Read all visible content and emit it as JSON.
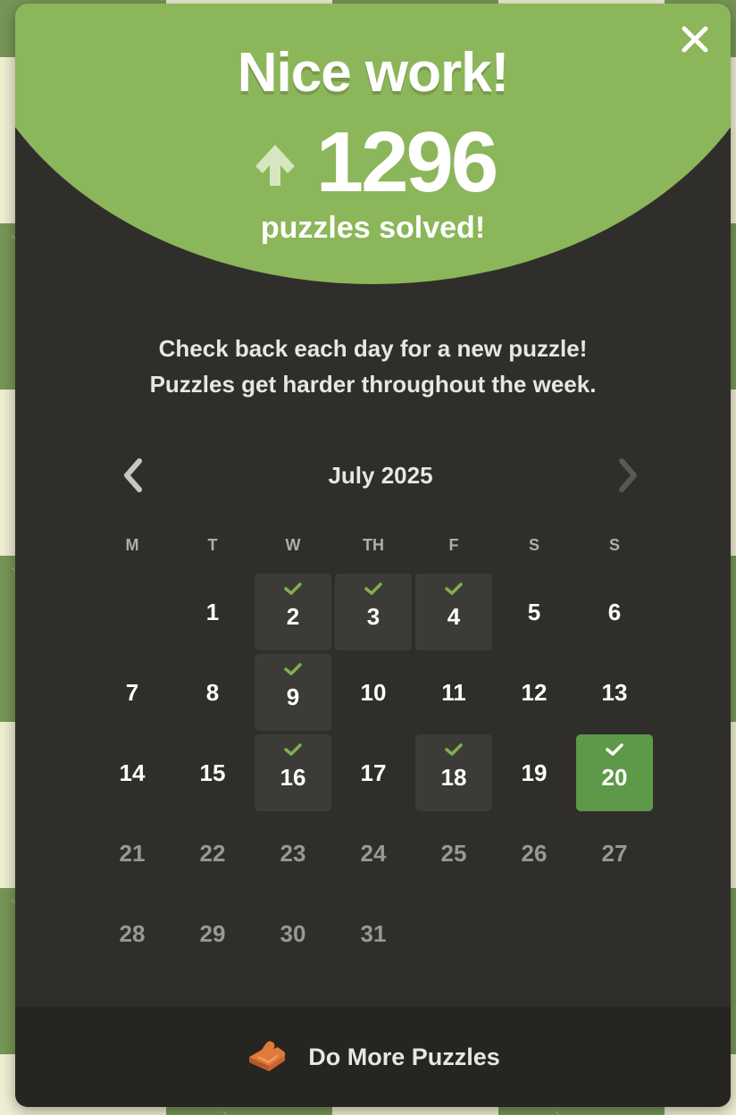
{
  "modal": {
    "title": "Nice work!",
    "count": "1296",
    "count_label": "puzzles solved!",
    "message_line1": "Check back each day for a new puzzle!",
    "message_line2": "Puzzles get harder throughout the week."
  },
  "calendar": {
    "month_label": "July 2025",
    "weekdays": [
      "M",
      "T",
      "W",
      "TH",
      "F",
      "S",
      "S"
    ],
    "leading_blanks": 1,
    "days": [
      {
        "d": "1",
        "state": "normal"
      },
      {
        "d": "2",
        "state": "solved"
      },
      {
        "d": "3",
        "state": "solved"
      },
      {
        "d": "4",
        "state": "solved"
      },
      {
        "d": "5",
        "state": "normal"
      },
      {
        "d": "6",
        "state": "normal"
      },
      {
        "d": "7",
        "state": "normal"
      },
      {
        "d": "8",
        "state": "normal"
      },
      {
        "d": "9",
        "state": "solved"
      },
      {
        "d": "10",
        "state": "normal"
      },
      {
        "d": "11",
        "state": "normal"
      },
      {
        "d": "12",
        "state": "normal"
      },
      {
        "d": "13",
        "state": "normal"
      },
      {
        "d": "14",
        "state": "normal"
      },
      {
        "d": "15",
        "state": "normal"
      },
      {
        "d": "16",
        "state": "solved"
      },
      {
        "d": "17",
        "state": "normal"
      },
      {
        "d": "18",
        "state": "solved"
      },
      {
        "d": "19",
        "state": "normal"
      },
      {
        "d": "20",
        "state": "today"
      },
      {
        "d": "21",
        "state": "future"
      },
      {
        "d": "22",
        "state": "future"
      },
      {
        "d": "23",
        "state": "future"
      },
      {
        "d": "24",
        "state": "future"
      },
      {
        "d": "25",
        "state": "future"
      },
      {
        "d": "26",
        "state": "future"
      },
      {
        "d": "27",
        "state": "future"
      },
      {
        "d": "28",
        "state": "future"
      },
      {
        "d": "29",
        "state": "future"
      },
      {
        "d": "30",
        "state": "future"
      },
      {
        "d": "31",
        "state": "future"
      }
    ]
  },
  "footer": {
    "label": "Do More Puzzles",
    "icon": "puzzle-piece-icon"
  },
  "colors": {
    "hero_green": "#8cb65a",
    "today_green": "#5d9948",
    "check_green": "#7fb04f",
    "modal_bg": "#302e2b",
    "footer_bg": "#262522",
    "puzzle_orange": "#e07a3a"
  }
}
